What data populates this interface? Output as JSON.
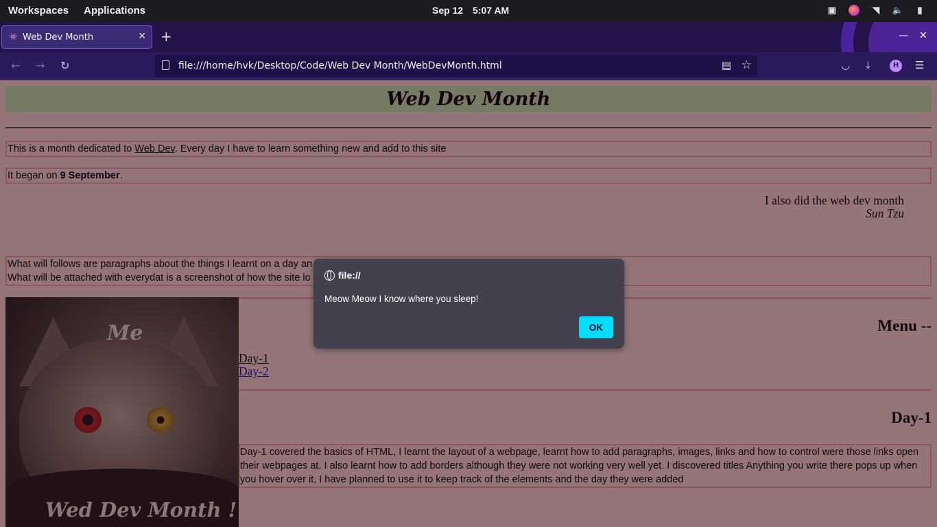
{
  "system_bar": {
    "workspaces": "Workspaces",
    "applications": "Applications",
    "date": "Sep 12",
    "time": "5:07 AM"
  },
  "browser": {
    "tab": {
      "title": "Web Dev Month",
      "close": "✕"
    },
    "new_tab": "+",
    "window": {
      "minimize": "—",
      "close": "✕"
    },
    "url": "file:///home/hvk/Desktop/Code/Web Dev Month/WebDevMonth.html",
    "profile_initial": "H"
  },
  "page": {
    "banner_title": "Web Dev Month",
    "intro_before": "This is a month dedicated to ",
    "intro_link": "Web Dev",
    "intro_after": ". Every day I have to learn something new and add to this site",
    "began_before": "It began on ",
    "began_bold": "9 September",
    "began_after": ".",
    "quote_text": "I also did the web dev month",
    "quote_author": "Sun Tzu",
    "follow_line1": "What will follows are paragraphs about the things I learnt on a day an",
    "follow_line2": "What will be attached with everydat is a screenshot of how the site lo",
    "image_caption_top": "Me",
    "image_caption_bottom": "Wed Dev Month !",
    "menu_heading": "Menu --",
    "menu_links": [
      "Day-1",
      "Day-2"
    ],
    "day1_heading": "Day-1",
    "day1_text": "Day-1 covered the basics of HTML, I learnt the layout of a webpage, learnt how to add paragraphs, images, links and how to control were those links open their webpages at. I also learnt how to add borders although they were not working very well yet. I discovered titles Anything you write there pops up when you hover over it, I have planned to use it to keep track of the elements and the day they were added"
  },
  "modal": {
    "origin": "file://",
    "message": "Meow Meow I know where you sleep!",
    "ok_label": "OK"
  }
}
